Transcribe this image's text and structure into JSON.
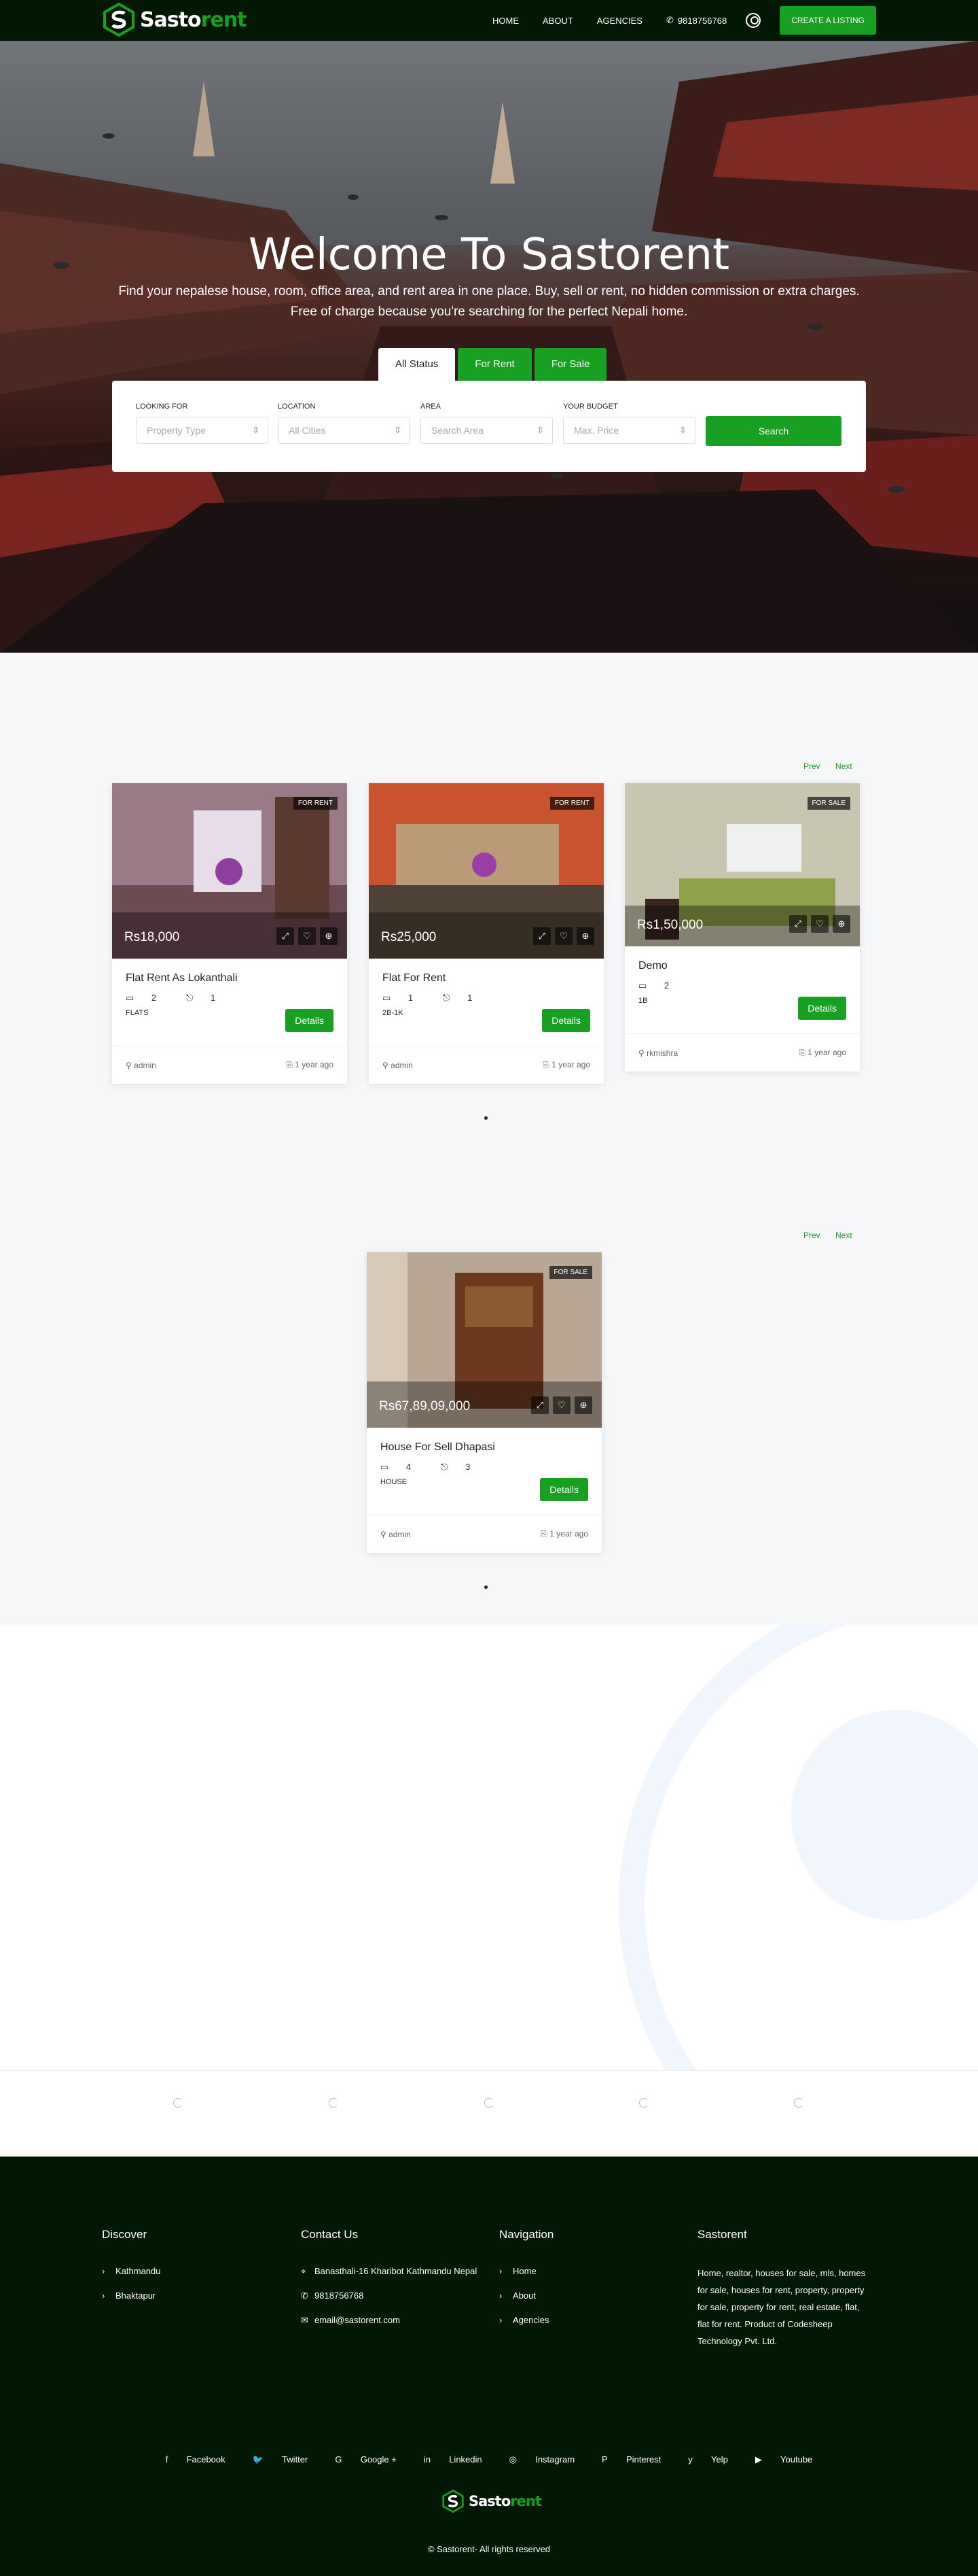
{
  "nav": {
    "logo_part1": "Sasto",
    "logo_part2": "rent",
    "links": [
      "HOME",
      "ABOUT",
      "AGENCIES"
    ],
    "phone": "9818756768",
    "cta": "CREATE A LISTING"
  },
  "hero": {
    "title": "Welcome To Sastorent",
    "subtitle": "Find your nepalese house, room, office area, and rent area in one place. Buy, sell or rent, no hidden commission or extra charges. Free of charge because you're searching for the perfect Nepali home.",
    "tabs": [
      "All Status",
      "For Rent",
      "For Sale"
    ],
    "fields": [
      {
        "label": "LOOKING FOR",
        "placeholder": "Property Type"
      },
      {
        "label": "LOCATION",
        "placeholder": "All Cities"
      },
      {
        "label": "AREA",
        "placeholder": "Search Area"
      },
      {
        "label": "YOUR BUDGET",
        "placeholder": "Max. Price"
      }
    ],
    "search_button": "Search"
  },
  "carousel1": {
    "prev": "Prev",
    "next": "Next",
    "cards": [
      {
        "badge": "FOR RENT",
        "price": "Rs18,000",
        "title": "Flat Rent As Lokanthali",
        "beds": "2",
        "baths": "1",
        "type": "FLATS",
        "details": "Details",
        "author": "admin",
        "date": "1 year ago"
      },
      {
        "badge": "FOR RENT",
        "price": "Rs25,000",
        "title": "Flat For Rent",
        "beds": "1",
        "baths": "1",
        "type": "2B-1K",
        "details": "Details",
        "author": "admin",
        "date": "1 year ago"
      },
      {
        "badge": "FOR SALE",
        "price": "Rs1,50,000",
        "title": "Demo",
        "beds": "2",
        "type": "1B",
        "details": "Details",
        "author": "rkmishra",
        "date": "1 year ago"
      }
    ]
  },
  "carousel2": {
    "prev": "Prev",
    "next": "Next",
    "cards": [
      {
        "badge": "FOR SALE",
        "price": "Rs67,89,09,000",
        "title": "House For Sell Dhapasi",
        "beds": "4",
        "baths": "3",
        "type": "HOUSE",
        "details": "Details",
        "author": "admin",
        "date": "1 year ago"
      }
    ]
  },
  "footer": {
    "discover_title": "Discover",
    "discover": [
      "Kathmandu",
      "Bhaktapur"
    ],
    "contact_title": "Contact Us",
    "address": "Banasthali-16 Kharibot Kathmandu Nepal",
    "phone": "9818756768",
    "email": "email@sastorent.com",
    "nav_title": "Navigation",
    "nav": [
      "Home",
      "About",
      "Agencies"
    ],
    "about_title": "Sastorent",
    "about_text": "Home, realtor, houses for sale, mls, homes for sale, houses for rent, property, property for sale, property for rent, real estate, flat, flat for rent. Product of Codesheep Technology Pvt. Ltd.",
    "social": [
      "Facebook",
      "Twitter",
      "Google +",
      "Linkedin",
      "Instagram",
      "Pinterest",
      "Yelp",
      "Youtube"
    ],
    "copyright": "© Sastorent- All rights reserved"
  },
  "colors": {
    "brand_green": "#17a022",
    "dark_bg": "#031804"
  }
}
